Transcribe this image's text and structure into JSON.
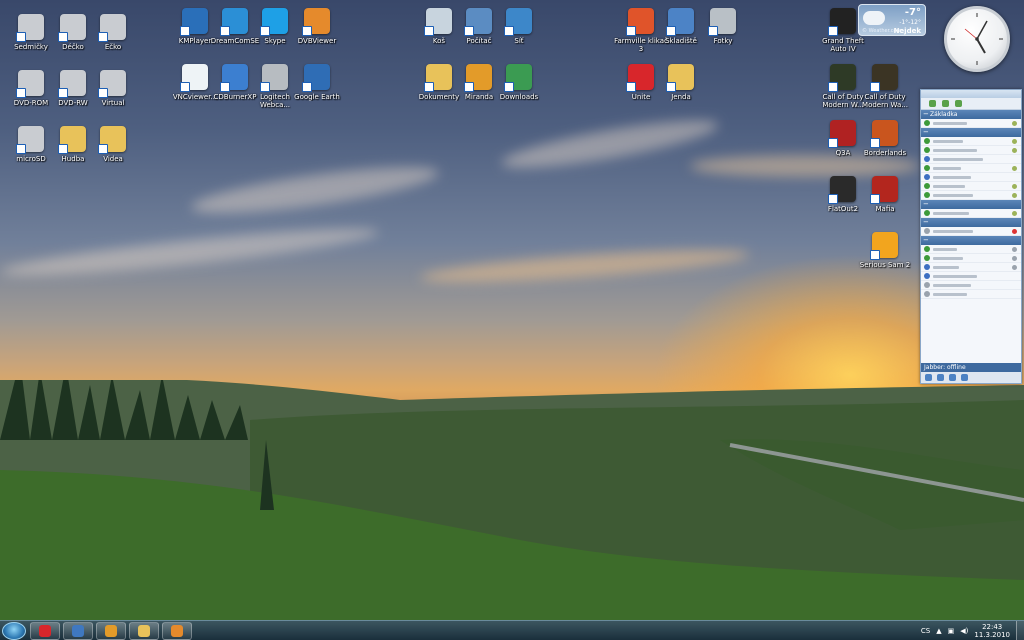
{
  "desktop_icons": [
    {
      "label": "Sedmičky",
      "icon": "folder-icon",
      "color": "#c9ccd1"
    },
    {
      "label": "Déčko",
      "icon": "drive-icon",
      "color": "#c9ccd1"
    },
    {
      "label": "Éčko",
      "icon": "drive-icon",
      "color": "#c9ccd1"
    },
    {
      "label": "DVD-ROM",
      "icon": "dvd-drive-icon",
      "color": "#c9ccd1"
    },
    {
      "label": "DVD-RW",
      "icon": "dvd-drive-icon",
      "color": "#c9ccd1"
    },
    {
      "label": "Virtual",
      "icon": "virtual-drive-icon",
      "color": "#c9ccd1"
    },
    {
      "label": "microSD",
      "icon": "sd-drive-icon",
      "color": "#c9ccd1"
    },
    {
      "label": "Hudba",
      "icon": "music-folder-icon",
      "color": "#e8c25a"
    },
    {
      "label": "Videa",
      "icon": "video-folder-icon",
      "color": "#e8c25a"
    },
    {
      "label": "KMPlayer",
      "icon": "kmplayer-icon",
      "color": "#2a6fb9"
    },
    {
      "label": "DreamComSE",
      "icon": "dreamcom-icon",
      "color": "#2b8fd6"
    },
    {
      "label": "Skype",
      "icon": "skype-icon",
      "color": "#1ea0e6"
    },
    {
      "label": "DVBViewer",
      "icon": "dvbviewer-icon",
      "color": "#e58a2c"
    },
    {
      "label": "VNCviewer...",
      "icon": "vnc-icon",
      "color": "#eef3f6"
    },
    {
      "label": "CDBurnerXP",
      "icon": "cdburner-icon",
      "color": "#3c7fd0"
    },
    {
      "label": "Logitech Webca...",
      "icon": "webcam-icon",
      "color": "#b7bcc1"
    },
    {
      "label": "Google Earth",
      "icon": "google-earth-icon",
      "color": "#2f6db5"
    },
    {
      "label": "Koš",
      "icon": "recycle-bin-icon",
      "color": "#c8d4de"
    },
    {
      "label": "Počítač",
      "icon": "computer-icon",
      "color": "#5b8cc2"
    },
    {
      "label": "Síť",
      "icon": "network-icon",
      "color": "#3d87c9"
    },
    {
      "label": "Dokumenty",
      "icon": "documents-folder-icon",
      "color": "#e8c25a"
    },
    {
      "label": "Miranda",
      "icon": "miranda-icon",
      "color": "#e39b29"
    },
    {
      "label": "Downloads",
      "icon": "downloads-icon",
      "color": "#3b9b52"
    },
    {
      "label": "Farmville klikač 3",
      "icon": "farmville-icon",
      "color": "#e0542a"
    },
    {
      "label": "Skladiště",
      "icon": "storage-icon",
      "color": "#4c83c6"
    },
    {
      "label": "Fotky",
      "icon": "camera-icon",
      "color": "#b9c0c6"
    },
    {
      "label": "Unite",
      "icon": "opera-unite-icon",
      "color": "#d8262b"
    },
    {
      "label": "Jenda",
      "icon": "user-folder-icon",
      "color": "#e8c25a"
    },
    {
      "label": "Grand Theft Auto IV",
      "icon": "gta4-icon",
      "color": "#222222"
    },
    {
      "label": "Call of Duty Modern W...",
      "icon": "cod-mw-icon",
      "color": "#2e3a26"
    },
    {
      "label": "Call of Duty Modern Wa...",
      "icon": "cod-mw2-icon",
      "color": "#3b3424"
    },
    {
      "label": "Q3A",
      "icon": "quake3-icon",
      "color": "#b02222"
    },
    {
      "label": "Borderlands",
      "icon": "borderlands-icon",
      "color": "#c9551e"
    },
    {
      "label": "FlatOut2",
      "icon": "flatout2-icon",
      "color": "#2a2a2a"
    },
    {
      "label": "Mafia",
      "icon": "mafia-icon",
      "color": "#b3261e"
    },
    {
      "label": "Serious Sam 2",
      "icon": "serious-sam-icon",
      "color": "#f2a51e"
    }
  ],
  "weather": {
    "temp": "-7°",
    "range": "-1°-12°",
    "city": "Nejdek",
    "source": "© Weather.com"
  },
  "miranda": {
    "group_label": "Základka",
    "status_label": "Jabber: offline"
  },
  "taskbar": {
    "buttons": [
      {
        "name": "opera-taskbar-button",
        "icon": "opera-icon",
        "color": "#d8262b"
      },
      {
        "name": "thunderbird-taskbar-button",
        "icon": "thunderbird-icon",
        "color": "#3f78c0"
      },
      {
        "name": "miranda-taskbar-button",
        "icon": "miranda-icon",
        "color": "#e39b29"
      },
      {
        "name": "explorer-taskbar-button",
        "icon": "folder-icon",
        "color": "#e8c25a"
      },
      {
        "name": "dvbviewer-taskbar-button",
        "icon": "dvbviewer-icon",
        "color": "#e58a2c"
      }
    ],
    "language": "CS",
    "time": "22:43",
    "date": "11.3.2010"
  }
}
